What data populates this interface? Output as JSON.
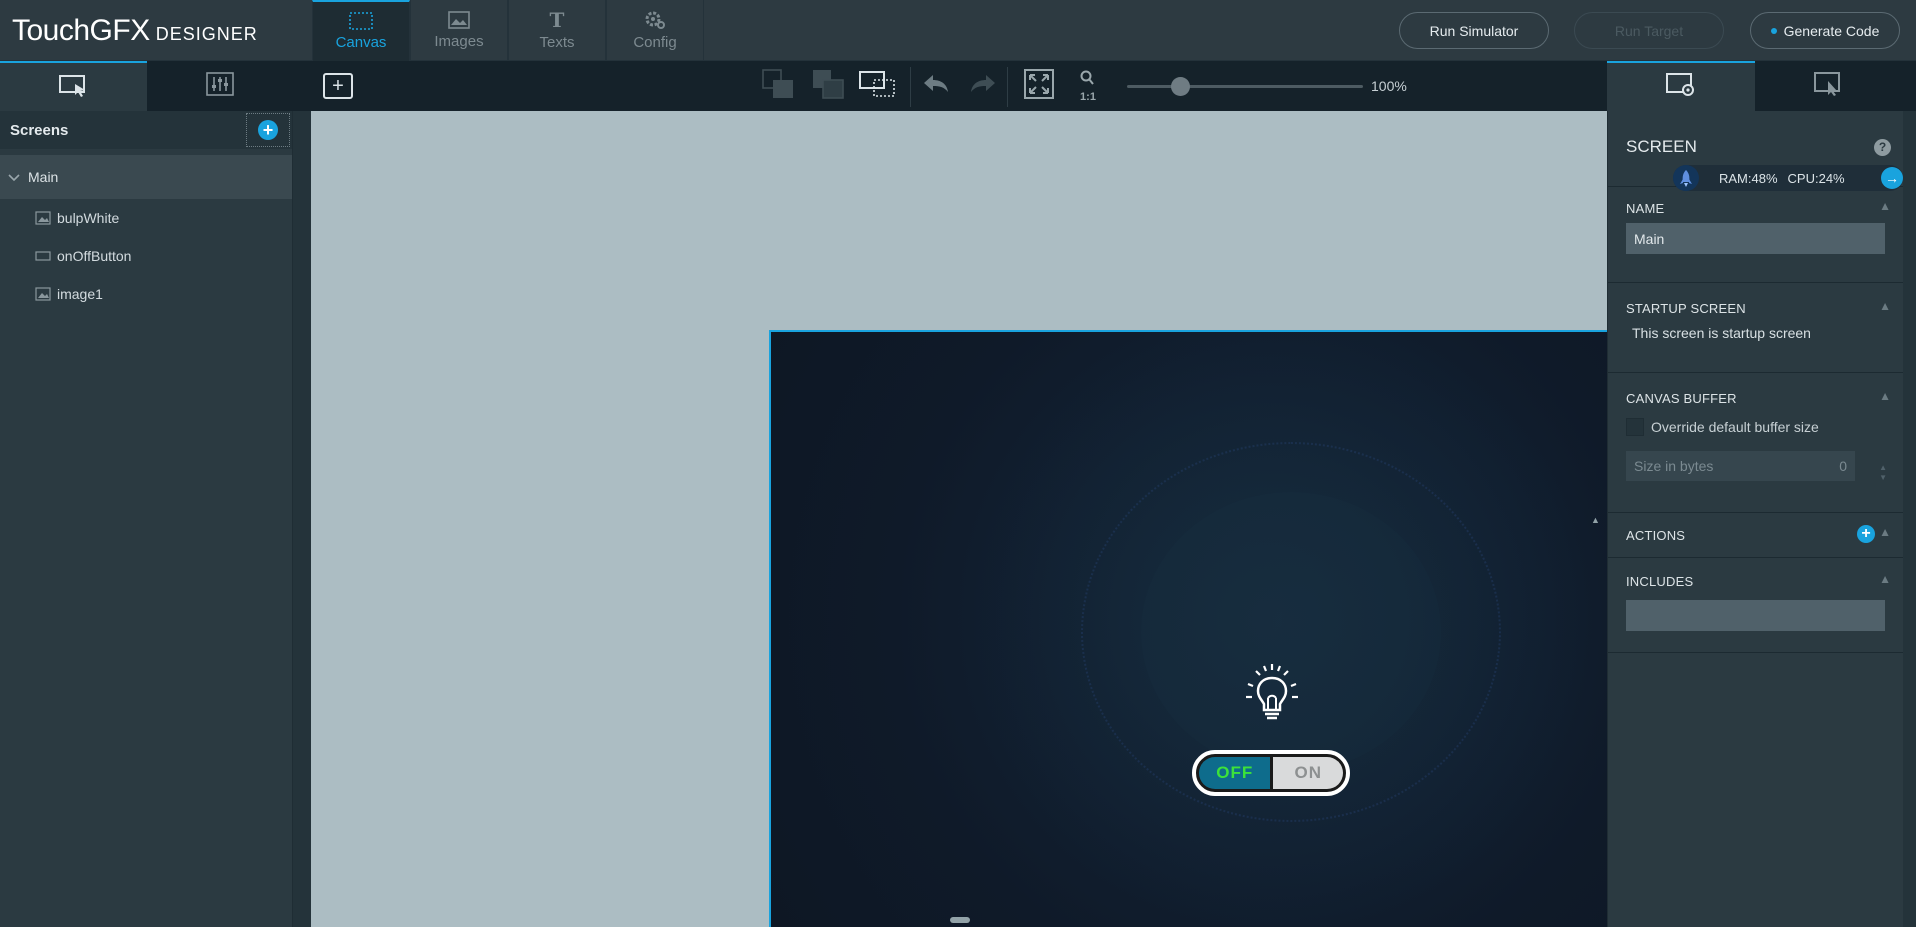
{
  "app": {
    "logo_main": "TouchGFX",
    "logo_sub": "DESIGNER"
  },
  "main_tabs": [
    {
      "label": "Canvas",
      "icon": "canvas-icon",
      "active": true
    },
    {
      "label": "Images",
      "icon": "image-icon",
      "active": false
    },
    {
      "label": "Texts",
      "icon": "text-icon",
      "active": false
    },
    {
      "label": "Config",
      "icon": "gear-icon",
      "active": false
    }
  ],
  "top_buttons": {
    "run_simulator": "Run Simulator",
    "run_target": "Run Target",
    "generate_code": "Generate Code"
  },
  "toolbar": {
    "zoom_label": "100%",
    "zoom_value_percent": 100,
    "zoom_reset_label": "1:1"
  },
  "screens_panel": {
    "title": "Screens",
    "root": "Main",
    "items": [
      {
        "label": "bulpWhite",
        "icon": "image-icon"
      },
      {
        "label": "onOffButton",
        "icon": "button-icon"
      },
      {
        "label": "image1",
        "icon": "image-icon"
      }
    ]
  },
  "canvas": {
    "toggle_off": "OFF",
    "toggle_on": "ON"
  },
  "properties": {
    "title": "SCREEN",
    "help": "?",
    "perf_ram": "RAM:48%",
    "perf_cpu": "CPU:24%",
    "name_section": "NAME",
    "name_value": "Main",
    "startup_section": "STARTUP SCREEN",
    "startup_text": "This screen is startup screen",
    "canvas_buffer_section": "CANVAS BUFFER",
    "override_label": "Override default buffer size",
    "size_placeholder": "Size in bytes",
    "size_value": "0",
    "actions_section": "ACTIONS",
    "includes_section": "INCLUDES"
  },
  "colors": {
    "accent": "#19a3de",
    "toggle_off_text": "#3ce23a",
    "canvas_bg": "#acbdc3"
  }
}
